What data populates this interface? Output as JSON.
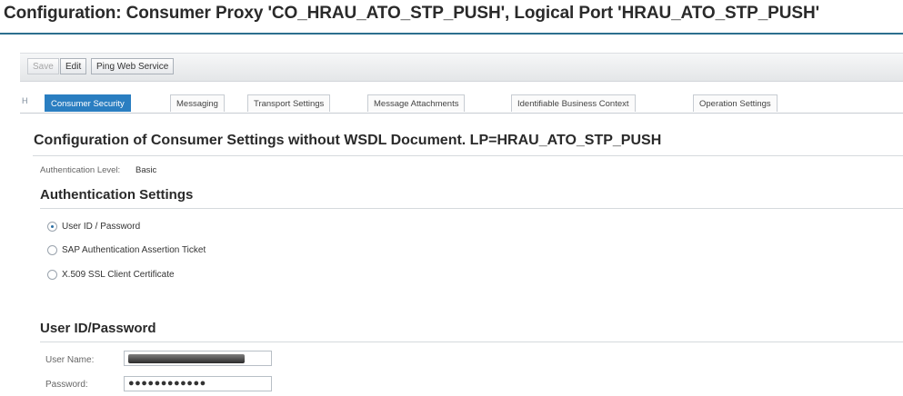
{
  "page": {
    "title": "Configuration: Consumer Proxy 'CO_HRAU_ATO_STP_PUSH', Logical Port 'HRAU_ATO_STP_PUSH'"
  },
  "toolbar": {
    "save_label": "Save",
    "edit_label": "Edit",
    "ping_label": "Ping Web Service"
  },
  "tabs": {
    "scroll_indicator": "H",
    "items": [
      {
        "label": "Consumer Security",
        "active": true
      },
      {
        "label": "Messaging",
        "active": false
      },
      {
        "label": "Transport Settings",
        "active": false
      },
      {
        "label": "Message Attachments",
        "active": false
      },
      {
        "label": "Identifiable Business Context",
        "active": false
      },
      {
        "label": "Operation Settings",
        "active": false
      }
    ]
  },
  "main": {
    "section_title": "Configuration of Consumer Settings without WSDL Document. LP=HRAU_ATO_STP_PUSH",
    "auth_level_label": "Authentication Level:",
    "auth_level_value": "Basic",
    "auth_settings_title": "Authentication Settings",
    "auth_options": [
      {
        "label": "User ID / Password",
        "selected": true
      },
      {
        "label": "SAP Authentication Assertion Ticket",
        "selected": false
      },
      {
        "label": "X.509 SSL Client Certificate",
        "selected": false
      }
    ],
    "userpw_title": "User ID/Password",
    "user_name_label": "User Name:",
    "password_label": "Password:",
    "password_value": "●●●●●●●●●●●●"
  },
  "colors": {
    "accent": "#2a7ec1",
    "title_rule": "#2c6f8e"
  }
}
